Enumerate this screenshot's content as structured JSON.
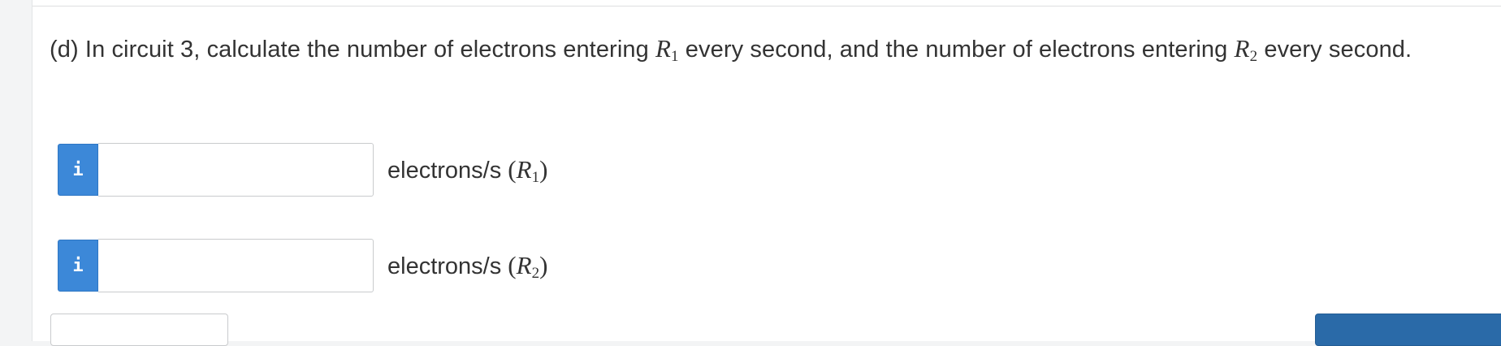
{
  "question": {
    "part": "(d)",
    "text_before_r1": " In circuit 3, calculate the number of electrons entering ",
    "text_between": " every second, and the number of electrons entering ",
    "text_after_r2": " every second."
  },
  "symbols": {
    "r1_letter": "R",
    "r1_sub": "1",
    "r2_letter": "R",
    "r2_sub": "2"
  },
  "answers": [
    {
      "info_glyph": "i",
      "value": "",
      "unit_prefix": "electrons/s ",
      "unit_resistor_letter": "R",
      "unit_resistor_sub": "1"
    },
    {
      "info_glyph": "i",
      "value": "",
      "unit_prefix": "electrons/s ",
      "unit_resistor_letter": "R",
      "unit_resistor_sub": "2"
    }
  ],
  "colors": {
    "accent": "#3c88d8",
    "text": "#333333"
  }
}
